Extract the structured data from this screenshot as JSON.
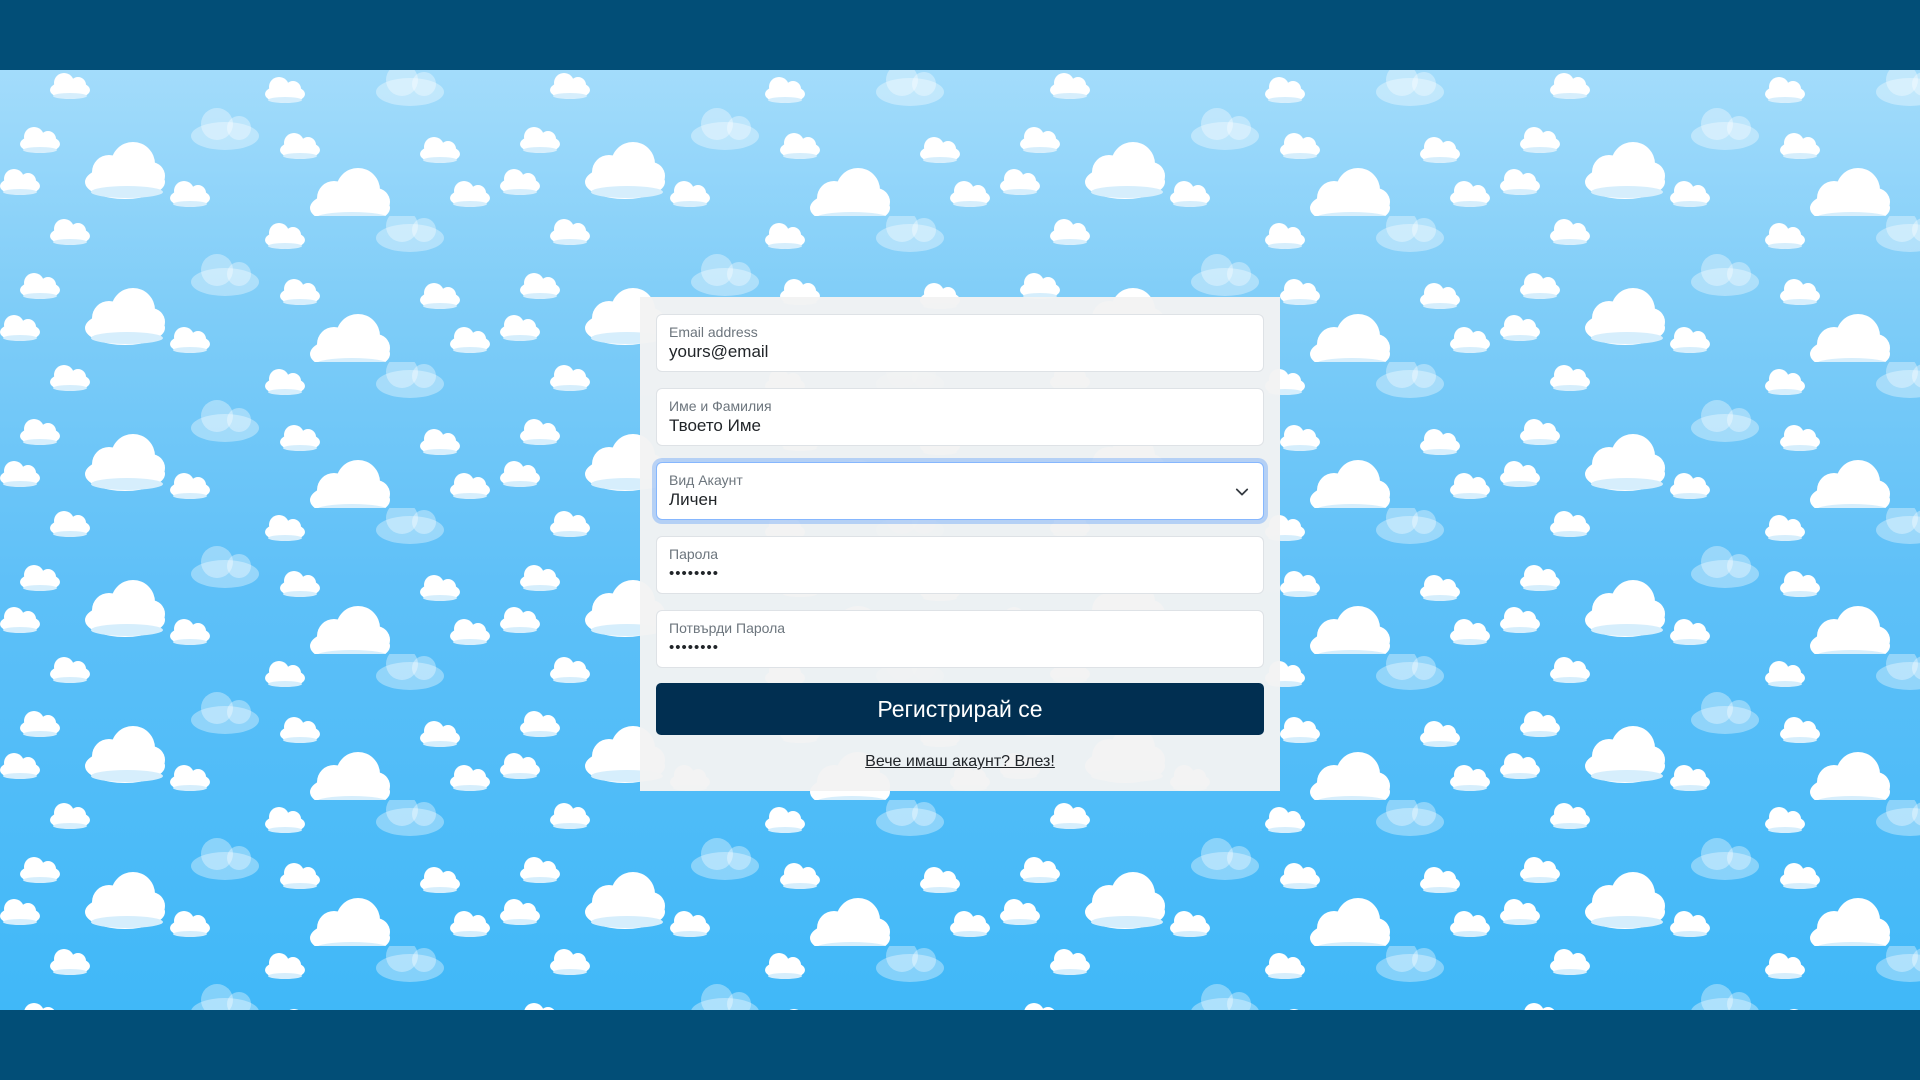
{
  "form": {
    "email": {
      "label": "Email address",
      "value": "yours@email"
    },
    "name": {
      "label": "Име и Фамилия",
      "value": "Твоето Име"
    },
    "account_type": {
      "label": "Вид Акаунт",
      "value": "Личен",
      "icon": "chevron-down-icon"
    },
    "password": {
      "label": "Парола",
      "value": "••••••••"
    },
    "confirm_password": {
      "label": "Потвърди Парола",
      "value": "••••••••"
    },
    "submit_label": "Регистрирай се",
    "login_link": "Вече имаш акаунт? Влез!"
  },
  "colors": {
    "frame": "#024e77",
    "button": "#012f51",
    "sky_top": "#a3dcfb",
    "sky_bottom": "#40b8f8"
  }
}
